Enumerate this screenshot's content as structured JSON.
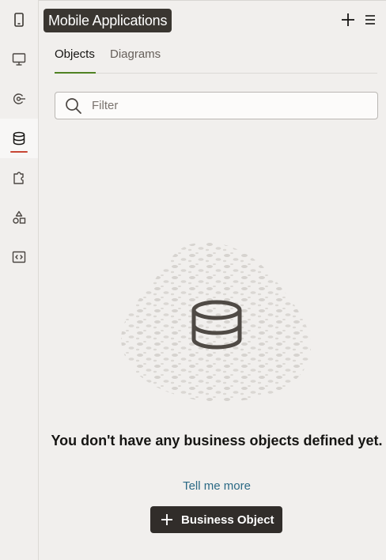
{
  "header": {
    "title": "Mobile Applications",
    "add_icon": "plus-icon",
    "menu_icon": "hamburger-menu-icon"
  },
  "rail": {
    "items": [
      {
        "icon": "mobile-device-icon",
        "name": "mobile-applications"
      },
      {
        "icon": "desktop-monitor-icon",
        "name": "web-applications"
      },
      {
        "icon": "service-connection-icon",
        "name": "services"
      },
      {
        "icon": "database-icon",
        "name": "business-objects",
        "active": true
      },
      {
        "icon": "puzzle-piece-icon",
        "name": "components"
      },
      {
        "icon": "shapes-icon",
        "name": "processes"
      },
      {
        "icon": "code-brackets-icon",
        "name": "source"
      }
    ],
    "active_indicator_color": "#c74634"
  },
  "tabs": [
    {
      "label": "Objects",
      "selected": true
    },
    {
      "label": "Diagrams",
      "selected": false
    }
  ],
  "filter": {
    "placeholder": "Filter",
    "value": ""
  },
  "empty_state": {
    "illustration_icon": "database-icon",
    "heading": "You don't have any business objects defined yet.",
    "link_text": "Tell me more",
    "button_label": "Business Object",
    "button_icon": "plus-icon"
  },
  "colors": {
    "background": "#f1efed",
    "title_chip": "#3a3631",
    "tab_underline": "#508223",
    "link": "#2c6a85",
    "primary_button": "#312d2a"
  }
}
